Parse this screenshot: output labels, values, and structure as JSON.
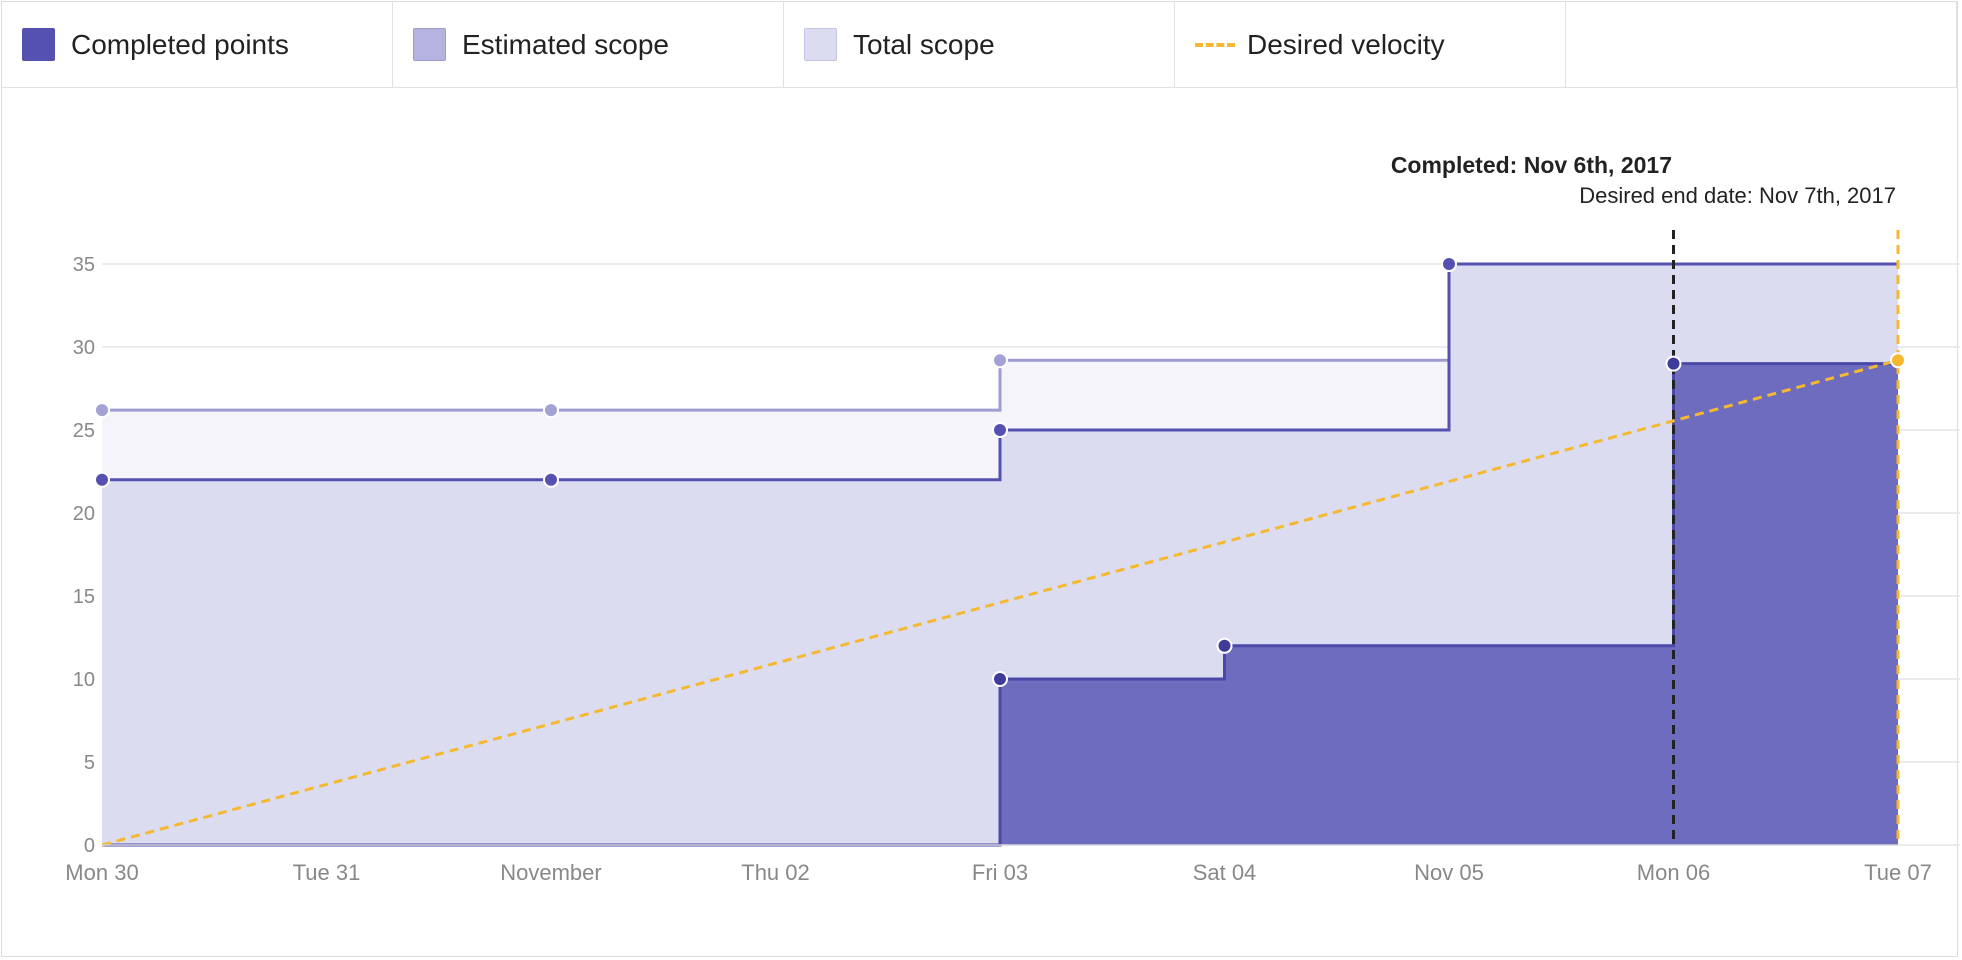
{
  "legend": {
    "items": [
      {
        "label": "Completed points",
        "kind": "completed",
        "color": "#5451b0"
      },
      {
        "label": "Estimated scope",
        "kind": "estimated",
        "color": "#b5b4e0"
      },
      {
        "label": "Total scope",
        "kind": "total",
        "color": "#dcdcf0"
      },
      {
        "label": "Desired velocity",
        "kind": "desired",
        "color": "#f5b931"
      }
    ]
  },
  "annotations": {
    "completed_label": "Completed: Nov 6th, 2017",
    "desired_end_label": "Desired end date: Nov 7th, 2017"
  },
  "chart_data": {
    "type": "area",
    "x": [
      "2017-10-30",
      "2017-10-31",
      "2017-11-01",
      "2017-11-02",
      "2017-11-03",
      "2017-11-04",
      "2017-11-05",
      "2017-11-06",
      "2017-11-07"
    ],
    "x_tick_labels": [
      "Mon 30",
      "Tue 31",
      "November",
      "Thu 02",
      "Fri 03",
      "Sat 04",
      "Nov 05",
      "Mon 06",
      "Tue 07"
    ],
    "y_ticks": [
      0,
      5,
      10,
      15,
      20,
      25,
      30,
      35
    ],
    "ylim": [
      0,
      35
    ],
    "grid": true,
    "legend_position": "top",
    "step": true,
    "series": [
      {
        "name": "Total scope",
        "color": "#5451b0",
        "fill": "#dcdcf0",
        "points": [
          [
            "2017-10-30",
            22
          ],
          [
            "2017-11-01",
            22
          ],
          [
            "2017-11-03",
            25
          ],
          [
            "2017-11-05",
            35
          ],
          [
            "2017-11-07",
            35
          ]
        ],
        "markers": [
          [
            "2017-10-30",
            22
          ],
          [
            "2017-11-01",
            22
          ],
          [
            "2017-11-03",
            25
          ],
          [
            "2017-11-05",
            35
          ]
        ]
      },
      {
        "name": "Estimated scope",
        "color": "#9e9cd2",
        "fill": "#f5f4fa",
        "points": [
          [
            "2017-10-30",
            26.2
          ],
          [
            "2017-11-01",
            26.2
          ],
          [
            "2017-11-03",
            29.2
          ],
          [
            "2017-11-05",
            29.2
          ]
        ],
        "markers": [
          [
            "2017-10-30",
            26.2
          ],
          [
            "2017-11-01",
            26.2
          ],
          [
            "2017-11-03",
            29.2
          ]
        ]
      },
      {
        "name": "Completed points",
        "color": "#4b48a8",
        "fill": "#6d6cbf",
        "points": [
          [
            "2017-10-30",
            0
          ],
          [
            "2017-11-03",
            10
          ],
          [
            "2017-11-04",
            12
          ],
          [
            "2017-11-06",
            29
          ],
          [
            "2017-11-07",
            29
          ]
        ],
        "markers": [
          [
            "2017-11-03",
            10
          ],
          [
            "2017-11-04",
            12
          ],
          [
            "2017-11-06",
            29
          ]
        ]
      },
      {
        "name": "Desired velocity",
        "color": "#f5b931",
        "dashed": true,
        "points": [
          [
            "2017-10-30",
            0
          ],
          [
            "2017-11-07",
            29.2
          ]
        ],
        "markers": [
          [
            "2017-11-07",
            29.2
          ]
        ]
      }
    ],
    "vertical_markers": [
      {
        "date": "2017-11-06",
        "color": "#222222"
      },
      {
        "date": "2017-11-07",
        "color": "#f5b931"
      }
    ]
  }
}
